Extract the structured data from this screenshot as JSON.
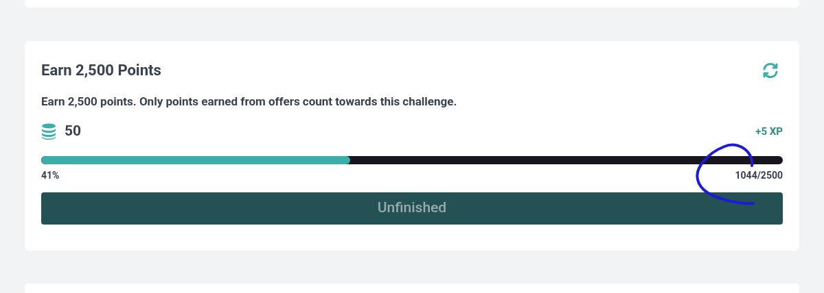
{
  "challenge": {
    "title": "Earn 2,500 Points",
    "description": "Earn 2,500 points. Only points earned from offers count towards this challenge.",
    "reward": "50",
    "xp": "+5 XP",
    "progress": {
      "level": 0.417,
      "percent": "41%",
      "count": "1044/2500"
    },
    "button": {
      "label": "Unfinished",
      "disabled": true
    }
  }
}
